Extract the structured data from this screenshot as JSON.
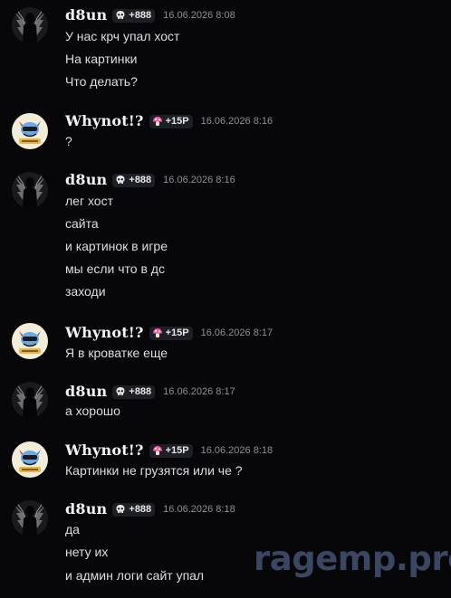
{
  "users": {
    "d8un": {
      "name": "d8un",
      "badge": "+888",
      "badge_icon": "skull-icon"
    },
    "whynot": {
      "name": "Whynot!?",
      "badge": "+15Р",
      "badge_icon": "mushroom-icon"
    }
  },
  "messages": [
    {
      "author": "d8un",
      "badge": "+888",
      "time": "16.06.2026 8:08",
      "lines": [
        "У нас крч упал хост",
        "На картинки",
        "Что делать?"
      ]
    },
    {
      "author": "Whynot!?",
      "badge": "+15Р",
      "time": "16.06.2026 8:16",
      "lines": [
        "?"
      ]
    },
    {
      "author": "d8un",
      "badge": "+888",
      "time": "16.06.2026 8:16",
      "lines": [
        "лег хост",
        "сайта",
        "и картинок в игре",
        "мы если что в дс",
        "заходи"
      ]
    },
    {
      "author": "Whynot!?",
      "badge": "+15Р",
      "time": "16.06.2026 8:17",
      "lines": [
        "Я в кроватке еще"
      ]
    },
    {
      "author": "d8un",
      "badge": "+888",
      "time": "16.06.2026 8:17",
      "lines": [
        "а хорошо"
      ]
    },
    {
      "author": "Whynot!?",
      "badge": "+15Р",
      "time": "16.06.2026 8:18",
      "lines": [
        "Картинки не грузятся или че ?"
      ]
    },
    {
      "author": "d8un",
      "badge": "+888",
      "time": "16.06.2026 8:18",
      "lines": [
        "да",
        "нету их",
        "и админ логи сайт упал"
      ]
    }
  ],
  "watermark": "ragemp.pro",
  "colors": {
    "background": "#070709",
    "text": "#dbdee1",
    "username": "#f2f3f5",
    "timestamp": "#8d9097",
    "badge_bg": "#1e1f24",
    "watermark": "#3b4663"
  }
}
